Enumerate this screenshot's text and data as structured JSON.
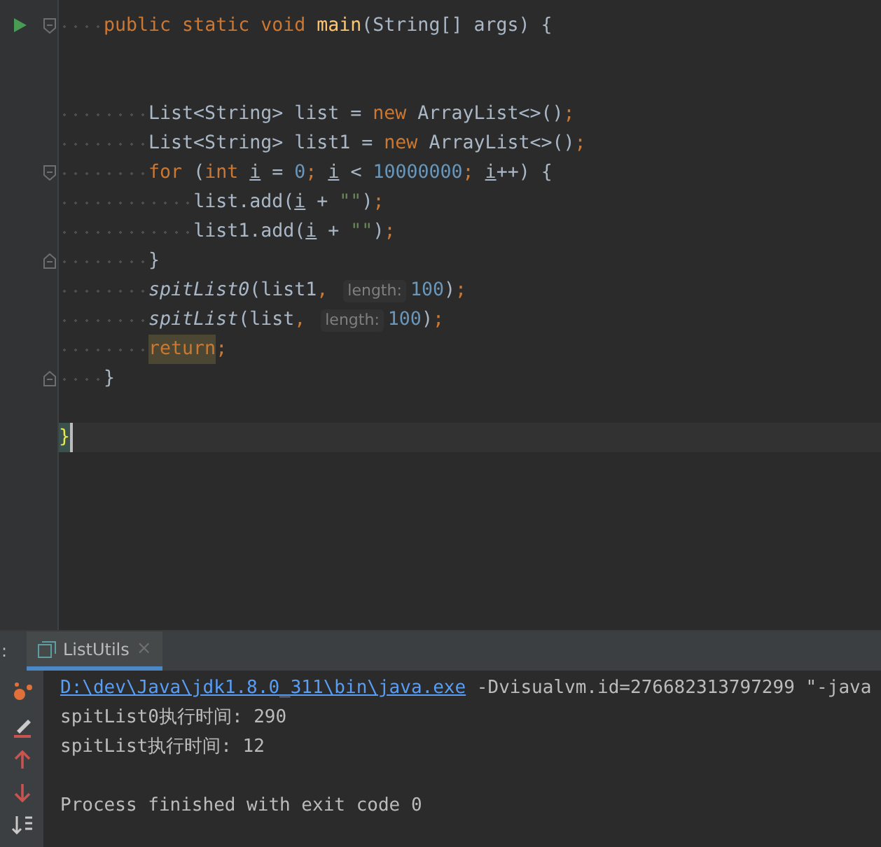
{
  "editor": {
    "class_body": [
      {
        "kind": "code",
        "runnable": true,
        "fold_start": true,
        "tokens": [
          {
            "kind": "kw",
            "text": "public static void "
          },
          {
            "kind": "decl",
            "text": "main"
          },
          {
            "kind": "plain",
            "text": "(String[] args) {"
          }
        ],
        "children": [
          {
            "kind": "blank"
          },
          {
            "kind": "blank"
          },
          {
            "kind": "code",
            "tokens": [
              {
                "kind": "plain",
                "text": "List<String> list = "
              },
              {
                "kind": "kw",
                "text": "new "
              },
              {
                "kind": "plain",
                "text": "ArrayList<>()"
              },
              {
                "kind": "kw",
                "text": ";"
              }
            ]
          },
          {
            "kind": "code",
            "tokens": [
              {
                "kind": "plain",
                "text": "List<String> list1 = "
              },
              {
                "kind": "kw",
                "text": "new "
              },
              {
                "kind": "plain",
                "text": "ArrayList<>()"
              },
              {
                "kind": "kw",
                "text": ";"
              }
            ]
          },
          {
            "kind": "code",
            "fold_start": true,
            "tokens": [
              {
                "kind": "kw",
                "text": "for "
              },
              {
                "kind": "plain",
                "text": "("
              },
              {
                "kind": "kw",
                "text": "int "
              },
              {
                "kind": "var",
                "text": "i"
              },
              {
                "kind": "plain",
                "text": " = "
              },
              {
                "kind": "num",
                "text": "0"
              },
              {
                "kind": "kw",
                "text": "; "
              },
              {
                "kind": "var",
                "text": "i"
              },
              {
                "kind": "plain",
                "text": " < "
              },
              {
                "kind": "num",
                "text": "10000000"
              },
              {
                "kind": "kw",
                "text": "; "
              },
              {
                "kind": "var",
                "text": "i"
              },
              {
                "kind": "plain",
                "text": "++) {"
              }
            ],
            "children": [
              {
                "kind": "code",
                "tokens": [
                  {
                    "kind": "plain",
                    "text": "list.add("
                  },
                  {
                    "kind": "var",
                    "text": "i"
                  },
                  {
                    "kind": "plain",
                    "text": " + "
                  },
                  {
                    "kind": "str",
                    "text": "\"\""
                  },
                  {
                    "kind": "plain",
                    "text": ")"
                  },
                  {
                    "kind": "kw",
                    "text": ";"
                  }
                ]
              },
              {
                "kind": "code",
                "tokens": [
                  {
                    "kind": "plain",
                    "text": "list1.add("
                  },
                  {
                    "kind": "var",
                    "text": "i"
                  },
                  {
                    "kind": "plain",
                    "text": " + "
                  },
                  {
                    "kind": "str",
                    "text": "\"\""
                  },
                  {
                    "kind": "plain",
                    "text": ")"
                  },
                  {
                    "kind": "kw",
                    "text": ";"
                  }
                ]
              }
            ]
          },
          {
            "kind": "code",
            "fold_end": true,
            "tokens": [
              {
                "kind": "plain",
                "text": "}"
              }
            ]
          },
          {
            "kind": "code",
            "tokens": [
              {
                "kind": "call",
                "text": "spitList0"
              },
              {
                "kind": "plain",
                "text": "(list1"
              },
              {
                "kind": "kw",
                "text": ", "
              },
              {
                "kind": "hint",
                "text": "length:"
              },
              {
                "kind": "num",
                "text": "100"
              },
              {
                "kind": "plain",
                "text": ")"
              },
              {
                "kind": "kw",
                "text": ";"
              }
            ]
          },
          {
            "kind": "code",
            "tokens": [
              {
                "kind": "call",
                "text": "spitList"
              },
              {
                "kind": "plain",
                "text": "(list"
              },
              {
                "kind": "kw",
                "text": ", "
              },
              {
                "kind": "hint",
                "text": "length:"
              },
              {
                "kind": "num",
                "text": "100"
              },
              {
                "kind": "plain",
                "text": ")"
              },
              {
                "kind": "kw",
                "text": ";"
              }
            ]
          },
          {
            "kind": "code",
            "tokens": [
              {
                "kind": "kwmark",
                "text": "return"
              },
              {
                "kind": "kw",
                "text": ";"
              }
            ]
          }
        ]
      },
      {
        "kind": "code",
        "fold_end": true,
        "tokens": [
          {
            "kind": "plain",
            "text": "}"
          }
        ]
      }
    ],
    "tail": [
      {
        "kind": "blank"
      },
      {
        "kind": "code",
        "current": true,
        "tokens": [
          {
            "kind": "brace",
            "text": "}"
          }
        ]
      }
    ]
  },
  "run_panel": {
    "label": ":",
    "tabs": [
      {
        "label": "ListUtils",
        "close": "×",
        "selected": true
      }
    ],
    "output": [
      {
        "kind": "text",
        "segments": [
          {
            "kind": "link",
            "text": "D:\\dev\\Java\\jdk1.8.0_311\\bin\\java.exe"
          },
          {
            "kind": "plain",
            "text": " -Dvisualvm.id=276682313797299 \"-java"
          }
        ]
      },
      {
        "kind": "text",
        "segments": [
          {
            "kind": "plain",
            "text": "spitList0执行时间: 290"
          }
        ]
      },
      {
        "kind": "text",
        "segments": [
          {
            "kind": "plain",
            "text": "spitList执行时间: 12"
          }
        ]
      },
      {
        "kind": "blank"
      },
      {
        "kind": "text",
        "segments": [
          {
            "kind": "plain",
            "text": "Process finished with exit code 0"
          }
        ]
      }
    ]
  }
}
